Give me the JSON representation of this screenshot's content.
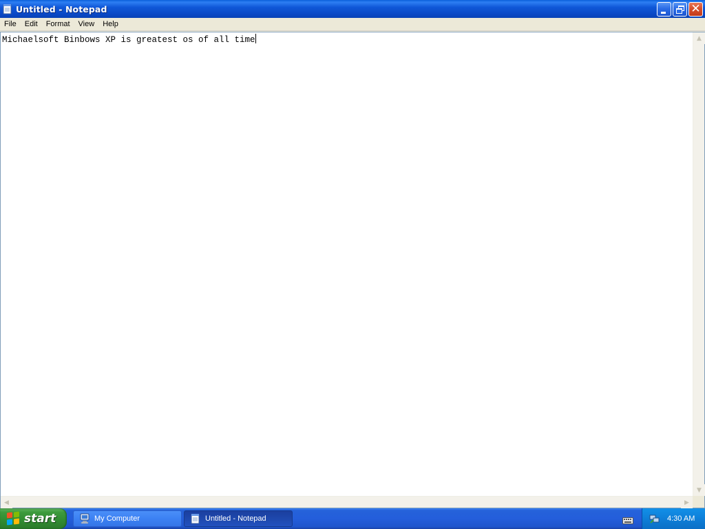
{
  "window": {
    "title": "Untitled - Notepad",
    "app_icon": "notepad-icon"
  },
  "menu": {
    "items": [
      "File",
      "Edit",
      "Format",
      "View",
      "Help"
    ]
  },
  "editor": {
    "text": "Michaelsoft Binbows XP is greatest os of all time"
  },
  "taskbar": {
    "start_label": "start",
    "tasks": [
      {
        "label": "My Computer",
        "icon": "my-computer-icon",
        "active": false
      },
      {
        "label": "Untitled - Notepad",
        "icon": "notepad-icon",
        "active": true
      }
    ],
    "clock": "4:30 AM",
    "tray_icons": [
      "keyboard-icon",
      "network-icon"
    ]
  },
  "colors": {
    "titlebar_blue": "#0A48C5",
    "taskbar_blue": "#245EDB",
    "start_green": "#3C9A3C",
    "close_red": "#D8502C",
    "tray_blue": "#0E7FD8"
  }
}
